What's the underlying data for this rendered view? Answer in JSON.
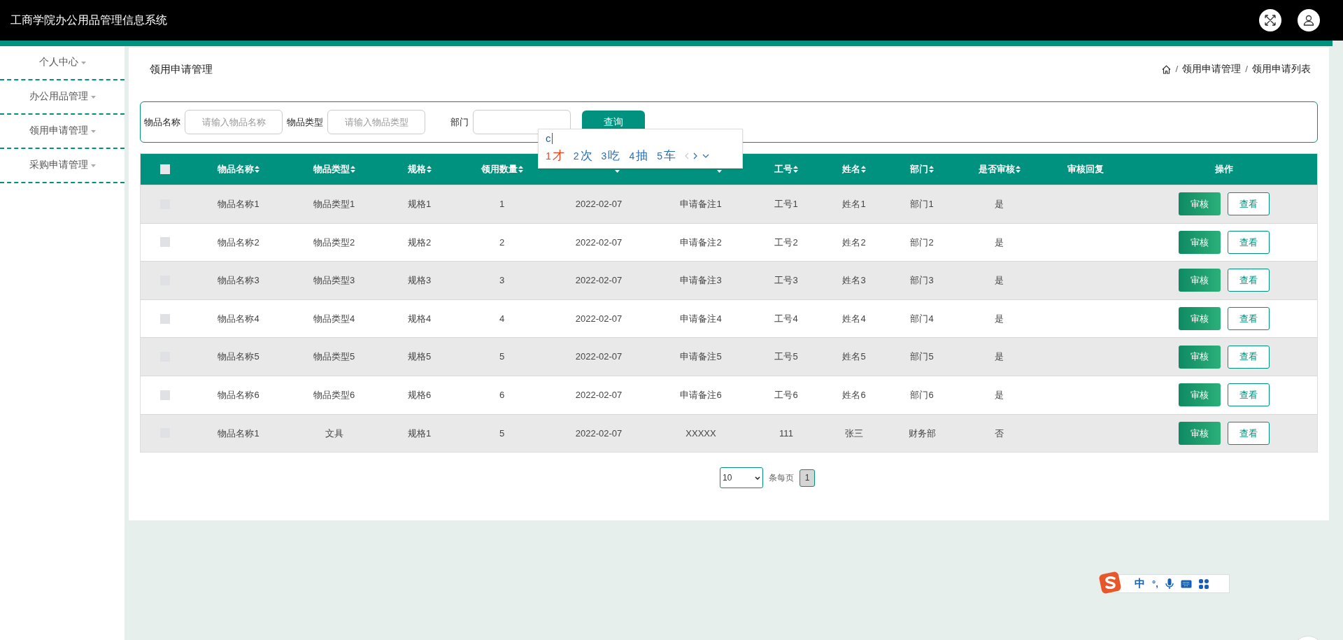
{
  "header": {
    "title": "工商学院办公用品管理信息系统"
  },
  "sidebar": {
    "items": [
      {
        "label": "个人中心"
      },
      {
        "label": "办公用品管理"
      },
      {
        "label": "领用申请管理"
      },
      {
        "label": "采购申请管理"
      }
    ]
  },
  "page": {
    "title": "领用申请管理",
    "breadcrumb": [
      {
        "kind": "separator",
        "text": "/"
      },
      {
        "kind": "link",
        "text": "领用申请管理"
      },
      {
        "kind": "separator",
        "text": "/"
      },
      {
        "kind": "link",
        "text": "领用申请列表"
      }
    ]
  },
  "search": {
    "fields": [
      {
        "label": "物品名称",
        "placeholder": "请输入物品名称"
      },
      {
        "label": "物品类型",
        "placeholder": "请输入物品类型"
      },
      {
        "label": "部门"
      }
    ],
    "button": "查询"
  },
  "ime": {
    "composition": "c",
    "candidates": [
      {
        "num": "1",
        "text": "才",
        "selected": true
      },
      {
        "num": "2",
        "text": "次",
        "selected": false
      },
      {
        "num": "3",
        "text": "吃",
        "selected": false
      },
      {
        "num": "4",
        "text": "抽",
        "selected": false
      },
      {
        "num": "5",
        "text": "车",
        "selected": false
      }
    ]
  },
  "table": {
    "header_checked": false,
    "columns": [
      {
        "label": "物品名称",
        "sortable": true
      },
      {
        "label": "物品类型",
        "sortable": true
      },
      {
        "label": "规格",
        "sortable": true
      },
      {
        "label": "领用数量",
        "sortable": true
      },
      {
        "sortable": true
      },
      {
        "sortable": true
      },
      {
        "label": "工号",
        "sortable": true
      },
      {
        "label": "姓名",
        "sortable": true
      },
      {
        "label": "部门",
        "sortable": true
      },
      {
        "label": "是否审核",
        "sortable": true
      },
      {
        "label": "审核回复",
        "sortable": false
      },
      {
        "label": "操作",
        "sortable": false
      }
    ],
    "rows": [
      {
        "checked": false,
        "cells": [
          "物品名称1",
          "物品类型1",
          "规格1",
          "1",
          "2022-02-07",
          "申请备注1",
          "工号1",
          "姓名1",
          "部门1",
          "是"
        ],
        "actions": [
          "审核",
          "查看"
        ]
      },
      {
        "checked": false,
        "cells": [
          "物品名称2",
          "物品类型2",
          "规格2",
          "2",
          "2022-02-07",
          "申请备注2",
          "工号2",
          "姓名2",
          "部门2",
          "是"
        ],
        "actions": [
          "审核",
          "查看"
        ]
      },
      {
        "checked": false,
        "cells": [
          "物品名称3",
          "物品类型3",
          "规格3",
          "3",
          "2022-02-07",
          "申请备注3",
          "工号3",
          "姓名3",
          "部门3",
          "是"
        ],
        "actions": [
          "审核",
          "查看"
        ]
      },
      {
        "checked": false,
        "cells": [
          "物品名称4",
          "物品类型4",
          "规格4",
          "4",
          "2022-02-07",
          "申请备注4",
          "工号4",
          "姓名4",
          "部门4",
          "是"
        ],
        "actions": [
          "审核",
          "查看"
        ]
      },
      {
        "checked": false,
        "cells": [
          "物品名称5",
          "物品类型5",
          "规格5",
          "5",
          "2022-02-07",
          "申请备注5",
          "工号5",
          "姓名5",
          "部门5",
          "是"
        ],
        "actions": [
          "审核",
          "查看"
        ]
      },
      {
        "checked": false,
        "cells": [
          "物品名称6",
          "物品类型6",
          "规格6",
          "6",
          "2022-02-07",
          "申请备注6",
          "工号6",
          "姓名6",
          "部门6",
          "是"
        ],
        "actions": [
          "审核",
          "查看"
        ]
      },
      {
        "checked": false,
        "cells": [
          "物品名称1",
          "文具",
          "规格1",
          "5",
          "2022-02-07",
          "XXXXX",
          "111",
          "张三",
          "财务部",
          "否"
        ],
        "actions": [
          "审核",
          "查看"
        ]
      }
    ]
  },
  "pagination": {
    "page_size": "10",
    "per_page_label": "条每页",
    "pages": [
      {
        "label": "1",
        "selected": true
      }
    ]
  },
  "ime_toolbar": {
    "mode": "中",
    "punct": "°,"
  }
}
